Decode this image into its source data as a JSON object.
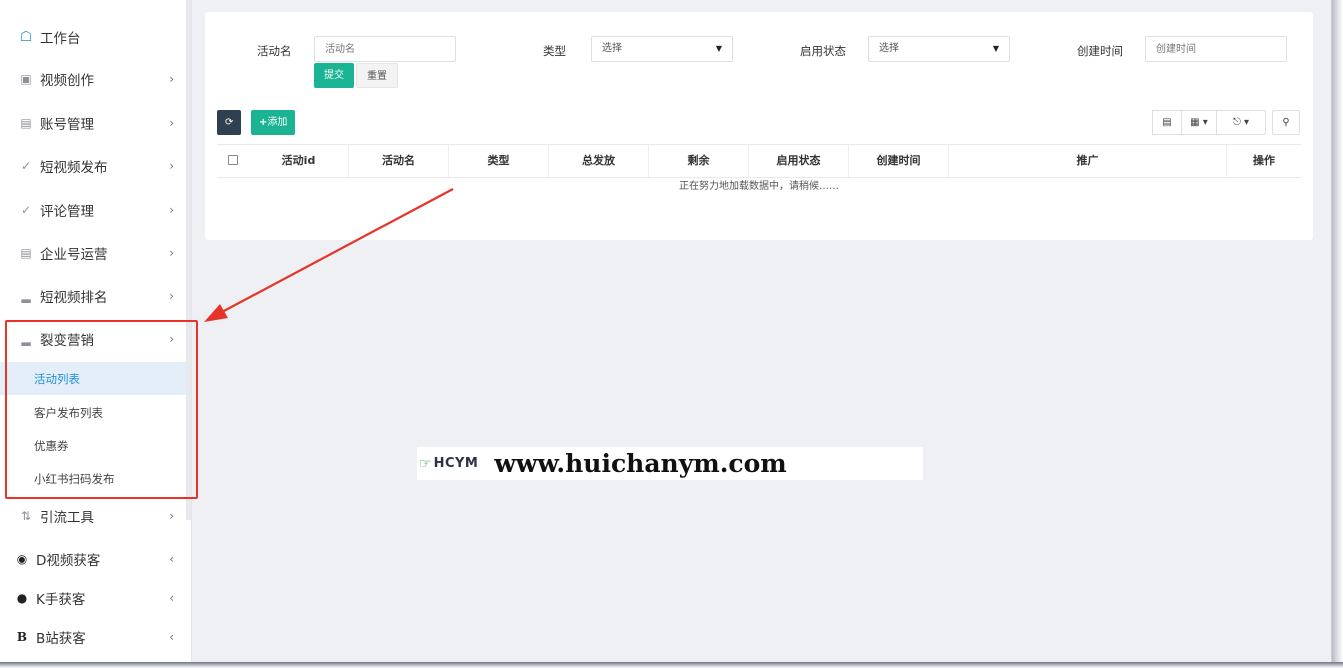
{
  "sidebar": {
    "home": {
      "label": "工作台",
      "icon": "home-icon"
    },
    "items": [
      {
        "label": "视频创作",
        "icon": "video-icon"
      },
      {
        "label": "账号管理",
        "icon": "account-icon"
      },
      {
        "label": "短视频发布",
        "icon": "send-icon"
      },
      {
        "label": "评论管理",
        "icon": "comment-icon"
      },
      {
        "label": "企业号运营",
        "icon": "enterprise-icon"
      },
      {
        "label": "短视频排名",
        "icon": "rank-icon"
      },
      {
        "label": "裂变营销",
        "icon": "marketing-icon"
      }
    ],
    "subitems": [
      {
        "label": "活动列表",
        "active": true
      },
      {
        "label": "客户发布列表"
      },
      {
        "label": "优惠券"
      },
      {
        "label": "小红书扫码发布"
      }
    ],
    "lower_items": [
      {
        "label": "引流工具",
        "icon": "tool-icon",
        "arrow": "›"
      },
      {
        "label": "D视频获客",
        "icon": "eye-icon",
        "arrow": "‹"
      },
      {
        "label": "K手获客",
        "icon": "k-icon",
        "arrow": "‹"
      },
      {
        "label": "B站获客",
        "icon": "b-icon",
        "mark": "B",
        "arrow": "‹"
      }
    ]
  },
  "filters": {
    "activity_name": {
      "label": "活动名",
      "placeholder": "活动名"
    },
    "type": {
      "label": "类型",
      "value": "选择"
    },
    "status": {
      "label": "启用状态",
      "value": "选择"
    },
    "created": {
      "label": "创建时间",
      "placeholder": "创建时间"
    },
    "submit": "提交",
    "reset": "重置"
  },
  "toolbar": {
    "add": "添加"
  },
  "table": {
    "columns": [
      "活动id",
      "活动名",
      "类型",
      "总发放",
      "剩余",
      "启用状态",
      "创建时间",
      "推广",
      "操作"
    ],
    "loading": "正在努力地加载数据中，请稍候……"
  },
  "watermark": {
    "logo": "HCYM",
    "url": "www.huichanym.com"
  },
  "colors": {
    "accent_green": "#1ab394",
    "highlight_red": "#e8332a",
    "link_blue": "#1e90d6"
  }
}
